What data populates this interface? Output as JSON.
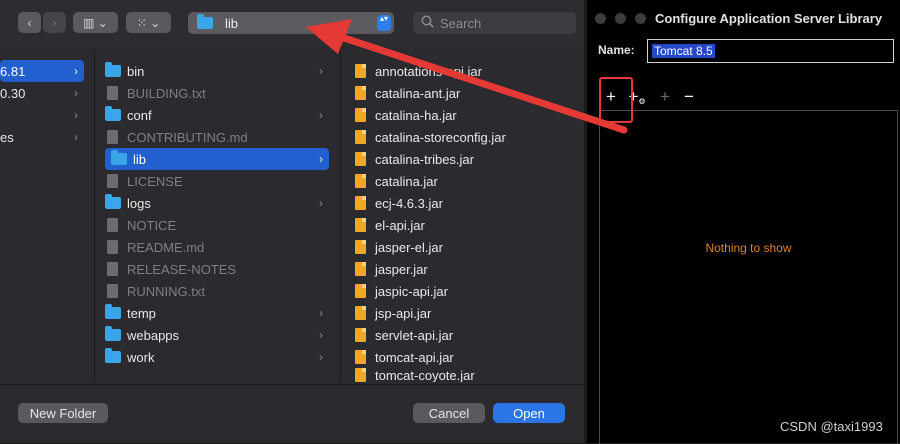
{
  "finder": {
    "nav": {
      "back": "‹",
      "forward": "›"
    },
    "view_buttons": {
      "columns": "▥ ⌄",
      "grid": "⁙ ⌄"
    },
    "path_popup": {
      "label": "lib",
      "stepper": "▴▾"
    },
    "search": {
      "placeholder": "Search"
    },
    "col1": [
      {
        "label": "6.81",
        "selected": true,
        "chevron": "›"
      },
      {
        "label": "0.30",
        "chevron": "›"
      },
      {
        "label": "",
        "chevron": "›"
      },
      {
        "label": "es",
        "chevron": "›"
      }
    ],
    "col2": [
      {
        "label": "bin",
        "type": "folder",
        "chevron": "›"
      },
      {
        "label": "BUILDING.txt",
        "type": "doc"
      },
      {
        "label": "conf",
        "type": "folder",
        "chevron": "›"
      },
      {
        "label": "CONTRIBUTING.md",
        "type": "doc"
      },
      {
        "label": "lib",
        "type": "folder",
        "chevron": "›",
        "selected": true
      },
      {
        "label": "LICENSE",
        "type": "doc"
      },
      {
        "label": "logs",
        "type": "folder",
        "chevron": "›"
      },
      {
        "label": "NOTICE",
        "type": "doc"
      },
      {
        "label": "README.md",
        "type": "doc"
      },
      {
        "label": "RELEASE-NOTES",
        "type": "doc"
      },
      {
        "label": "RUNNING.txt",
        "type": "doc"
      },
      {
        "label": "temp",
        "type": "folder",
        "chevron": "›"
      },
      {
        "label": "webapps",
        "type": "folder",
        "chevron": "›"
      },
      {
        "label": "work",
        "type": "folder",
        "chevron": "›"
      }
    ],
    "col3": [
      "annotations-api.jar",
      "catalina-ant.jar",
      "catalina-ha.jar",
      "catalina-storeconfig.jar",
      "catalina-tribes.jar",
      "catalina.jar",
      "ecj-4.6.3.jar",
      "el-api.jar",
      "jasper-el.jar",
      "jasper.jar",
      "jaspic-api.jar",
      "jsp-api.jar",
      "servlet-api.jar",
      "tomcat-api.jar",
      "tomcat-coyote.jar"
    ],
    "footer": {
      "new_folder": "New Folder",
      "cancel": "Cancel",
      "open": "Open"
    }
  },
  "dialog": {
    "title": "Configure Application Server Library",
    "name_label": "Name:",
    "name_value": "Tomcat 8.5",
    "actions": {
      "add": "+",
      "add_special": "+",
      "add_disabled": "+",
      "remove": "−"
    },
    "empty_text": "Nothing to show"
  },
  "watermark": "CSDN @taxi1993",
  "colors": {
    "selection": "#2260cf",
    "annotation": "#e53935",
    "empty_text": "#d9822b",
    "jar_icon": "#f5a623",
    "folder_icon": "#3aa6e8"
  }
}
